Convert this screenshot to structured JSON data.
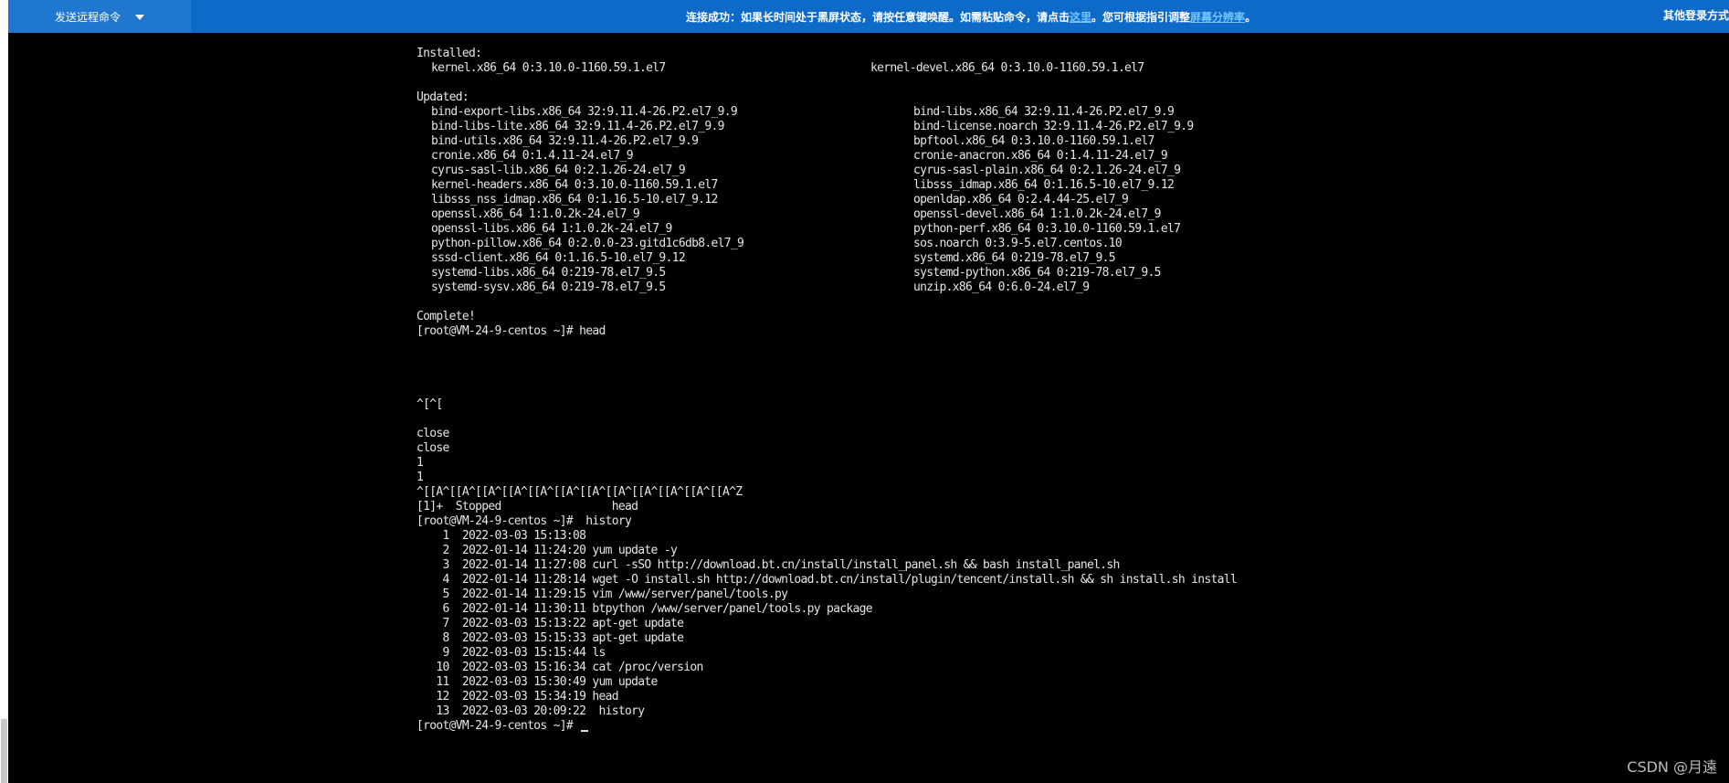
{
  "toolbar": {
    "send_remote_command": "发送远程命令",
    "notice_prefix": "连接成功：如果长时间处于黑屏状态，请按任意键唤醒。如需粘贴命令，请点击",
    "notice_link1": "这里",
    "notice_middle": "。您可根据指引调整",
    "notice_link2": "屏幕分辨率",
    "notice_suffix": "。",
    "other_login": "其他登录方式"
  },
  "terminal": {
    "installed_header": "Installed:",
    "installed": [
      [
        "kernel.x86_64 0:3.10.0-1160.59.1.el7",
        "kernel-devel.x86_64 0:3.10.0-1160.59.1.el7"
      ]
    ],
    "updated_header": "Updated:",
    "updated": [
      [
        "bind-export-libs.x86_64 32:9.11.4-26.P2.el7_9.9",
        "bind-libs.x86_64 32:9.11.4-26.P2.el7_9.9"
      ],
      [
        "bind-libs-lite.x86_64 32:9.11.4-26.P2.el7_9.9",
        "bind-license.noarch 32:9.11.4-26.P2.el7_9.9"
      ],
      [
        "bind-utils.x86_64 32:9.11.4-26.P2.el7_9.9",
        "bpftool.x86_64 0:3.10.0-1160.59.1.el7"
      ],
      [
        "cronie.x86_64 0:1.4.11-24.el7_9",
        "cronie-anacron.x86_64 0:1.4.11-24.el7_9"
      ],
      [
        "cyrus-sasl-lib.x86_64 0:2.1.26-24.el7_9",
        "cyrus-sasl-plain.x86_64 0:2.1.26-24.el7_9"
      ],
      [
        "kernel-headers.x86_64 0:3.10.0-1160.59.1.el7",
        "libsss_idmap.x86_64 0:1.16.5-10.el7_9.12"
      ],
      [
        "libsss_nss_idmap.x86_64 0:1.16.5-10.el7_9.12",
        "openldap.x86_64 0:2.4.44-25.el7_9"
      ],
      [
        "openssl.x86_64 1:1.0.2k-24.el7_9",
        "openssl-devel.x86_64 1:1.0.2k-24.el7_9"
      ],
      [
        "openssl-libs.x86_64 1:1.0.2k-24.el7_9",
        "python-perf.x86_64 0:3.10.0-1160.59.1.el7"
      ],
      [
        "python-pillow.x86_64 0:2.0.0-23.gitd1c6db8.el7_9",
        "sos.noarch 0:3.9-5.el7.centos.10"
      ],
      [
        "sssd-client.x86_64 0:1.16.5-10.el7_9.12",
        "systemd.x86_64 0:219-78.el7_9.5"
      ],
      [
        "systemd-libs.x86_64 0:219-78.el7_9.5",
        "systemd-python.x86_64 0:219-78.el7_9.5"
      ],
      [
        "systemd-sysv.x86_64 0:219-78.el7_9.5",
        "unzip.x86_64 0:6.0-24.el7_9"
      ]
    ],
    "complete": "Complete!",
    "prompt_head": "[root@VM-24-9-centos ~]# head",
    "esc_line": "^[^[",
    "close1": "close",
    "close2": "close",
    "one1": "1",
    "one2": "1",
    "arrows": "^[[A^[[A^[[A^[[A^[[A^[[A^[[A^[[A^[[A^[[A^[[A^[[A^Z",
    "stopped": "[1]+  Stopped                 head",
    "prompt_history": "[root@VM-24-9-centos ~]#  history",
    "history": [
      "    1  2022-03-03 15:13:08 ",
      "    2  2022-01-14 11:24:20 yum update -y",
      "    3  2022-01-14 11:27:08 curl -sSO http://download.bt.cn/install/install_panel.sh && bash install_panel.sh",
      "    4  2022-01-14 11:28:14 wget -O install.sh http://download.bt.cn/install/plugin/tencent/install.sh && sh install.sh install",
      "    5  2022-01-14 11:29:15 vim /www/server/panel/tools.py",
      "    6  2022-01-14 11:30:11 btpython /www/server/panel/tools.py package",
      "    7  2022-03-03 15:13:22 apt-get update",
      "    8  2022-03-03 15:15:33 apt-get update",
      "    9  2022-03-03 15:15:44 ls",
      "   10  2022-03-03 15:16:34 cat /proc/version",
      "   11  2022-03-03 15:30:49 yum update",
      "   12  2022-03-03 15:34:19 head",
      "   13  2022-03-03 20:09:22  history"
    ],
    "final_prompt": "[root@VM-24-9-centos ~]# "
  },
  "watermark": "CSDN @月遠"
}
